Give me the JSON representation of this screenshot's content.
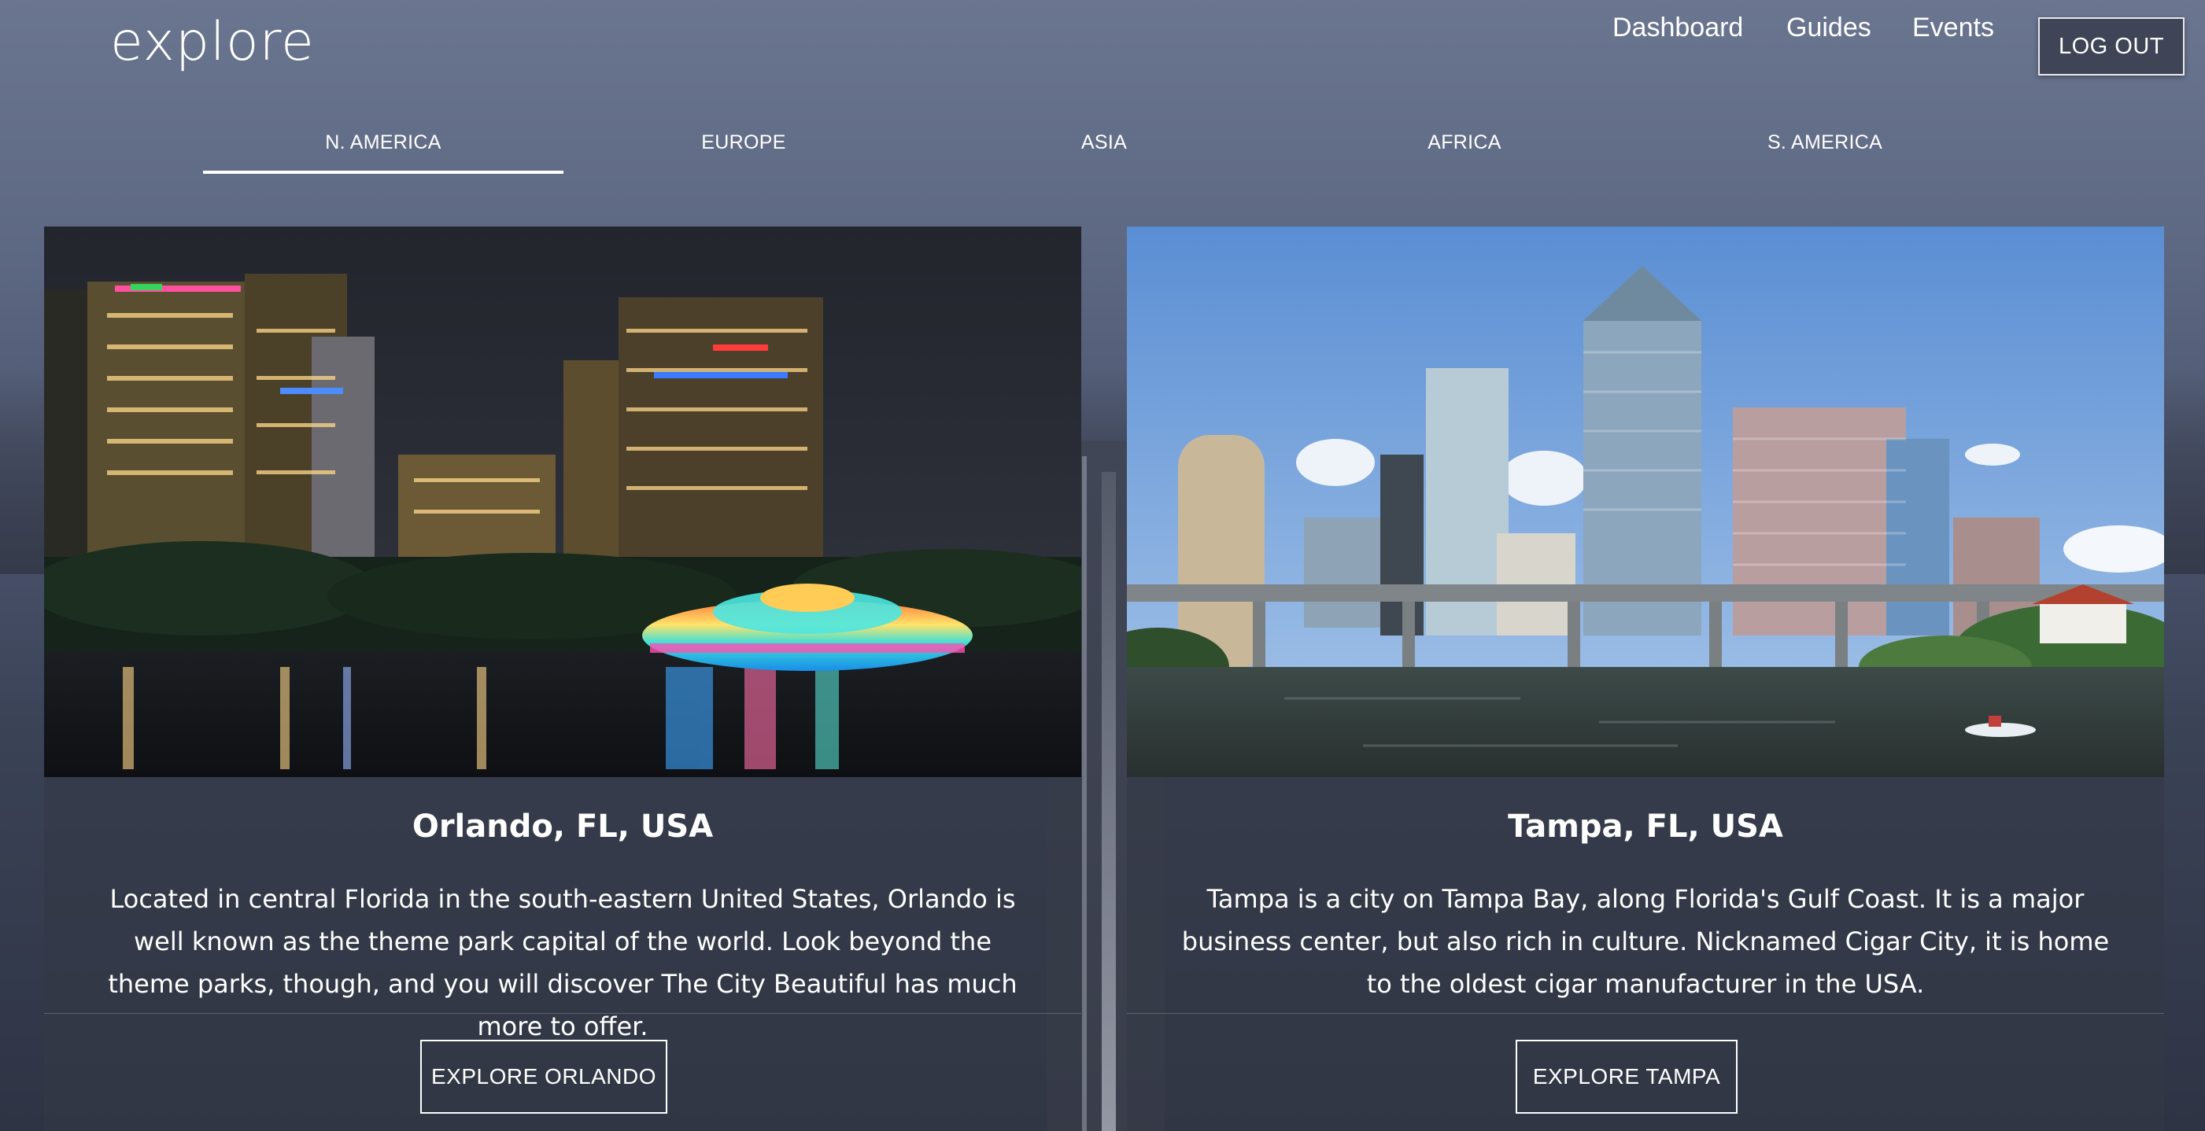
{
  "brand": {
    "name": "explore"
  },
  "nav": {
    "links": [
      "Dashboard",
      "Guides",
      "Events"
    ],
    "logout_label": "LOG OUT"
  },
  "tabs": {
    "items": [
      "N. AMERICA",
      "EUROPE",
      "ASIA",
      "AFRICA",
      "S. AMERICA"
    ],
    "active": "N. AMERICA"
  },
  "cards": [
    {
      "image": "orlando-night-skyline-fountain",
      "title": "Orlando, FL, USA",
      "description": "Located in central Florida in the south-eastern United States, Orlando is well known as the theme park capital of the world. Look beyond the theme parks, though, and you will discover The City Beautiful has much more to offer.",
      "button": "EXPLORE ORLANDO"
    },
    {
      "image": "tampa-daytime-skyline-river",
      "title": "Tampa, FL, USA",
      "description": "Tampa is a city on Tampa Bay, along Florida's Gulf Coast. It is a major business center, but also rich in culture. Nicknamed Cigar City, it is home to the oldest cigar manufacturer in the USA.",
      "button": "EXPLORE TAMPA"
    }
  ],
  "colors": {
    "background": "#5d6882",
    "card_overlay": "#343846",
    "button_border": "#ffffff"
  }
}
